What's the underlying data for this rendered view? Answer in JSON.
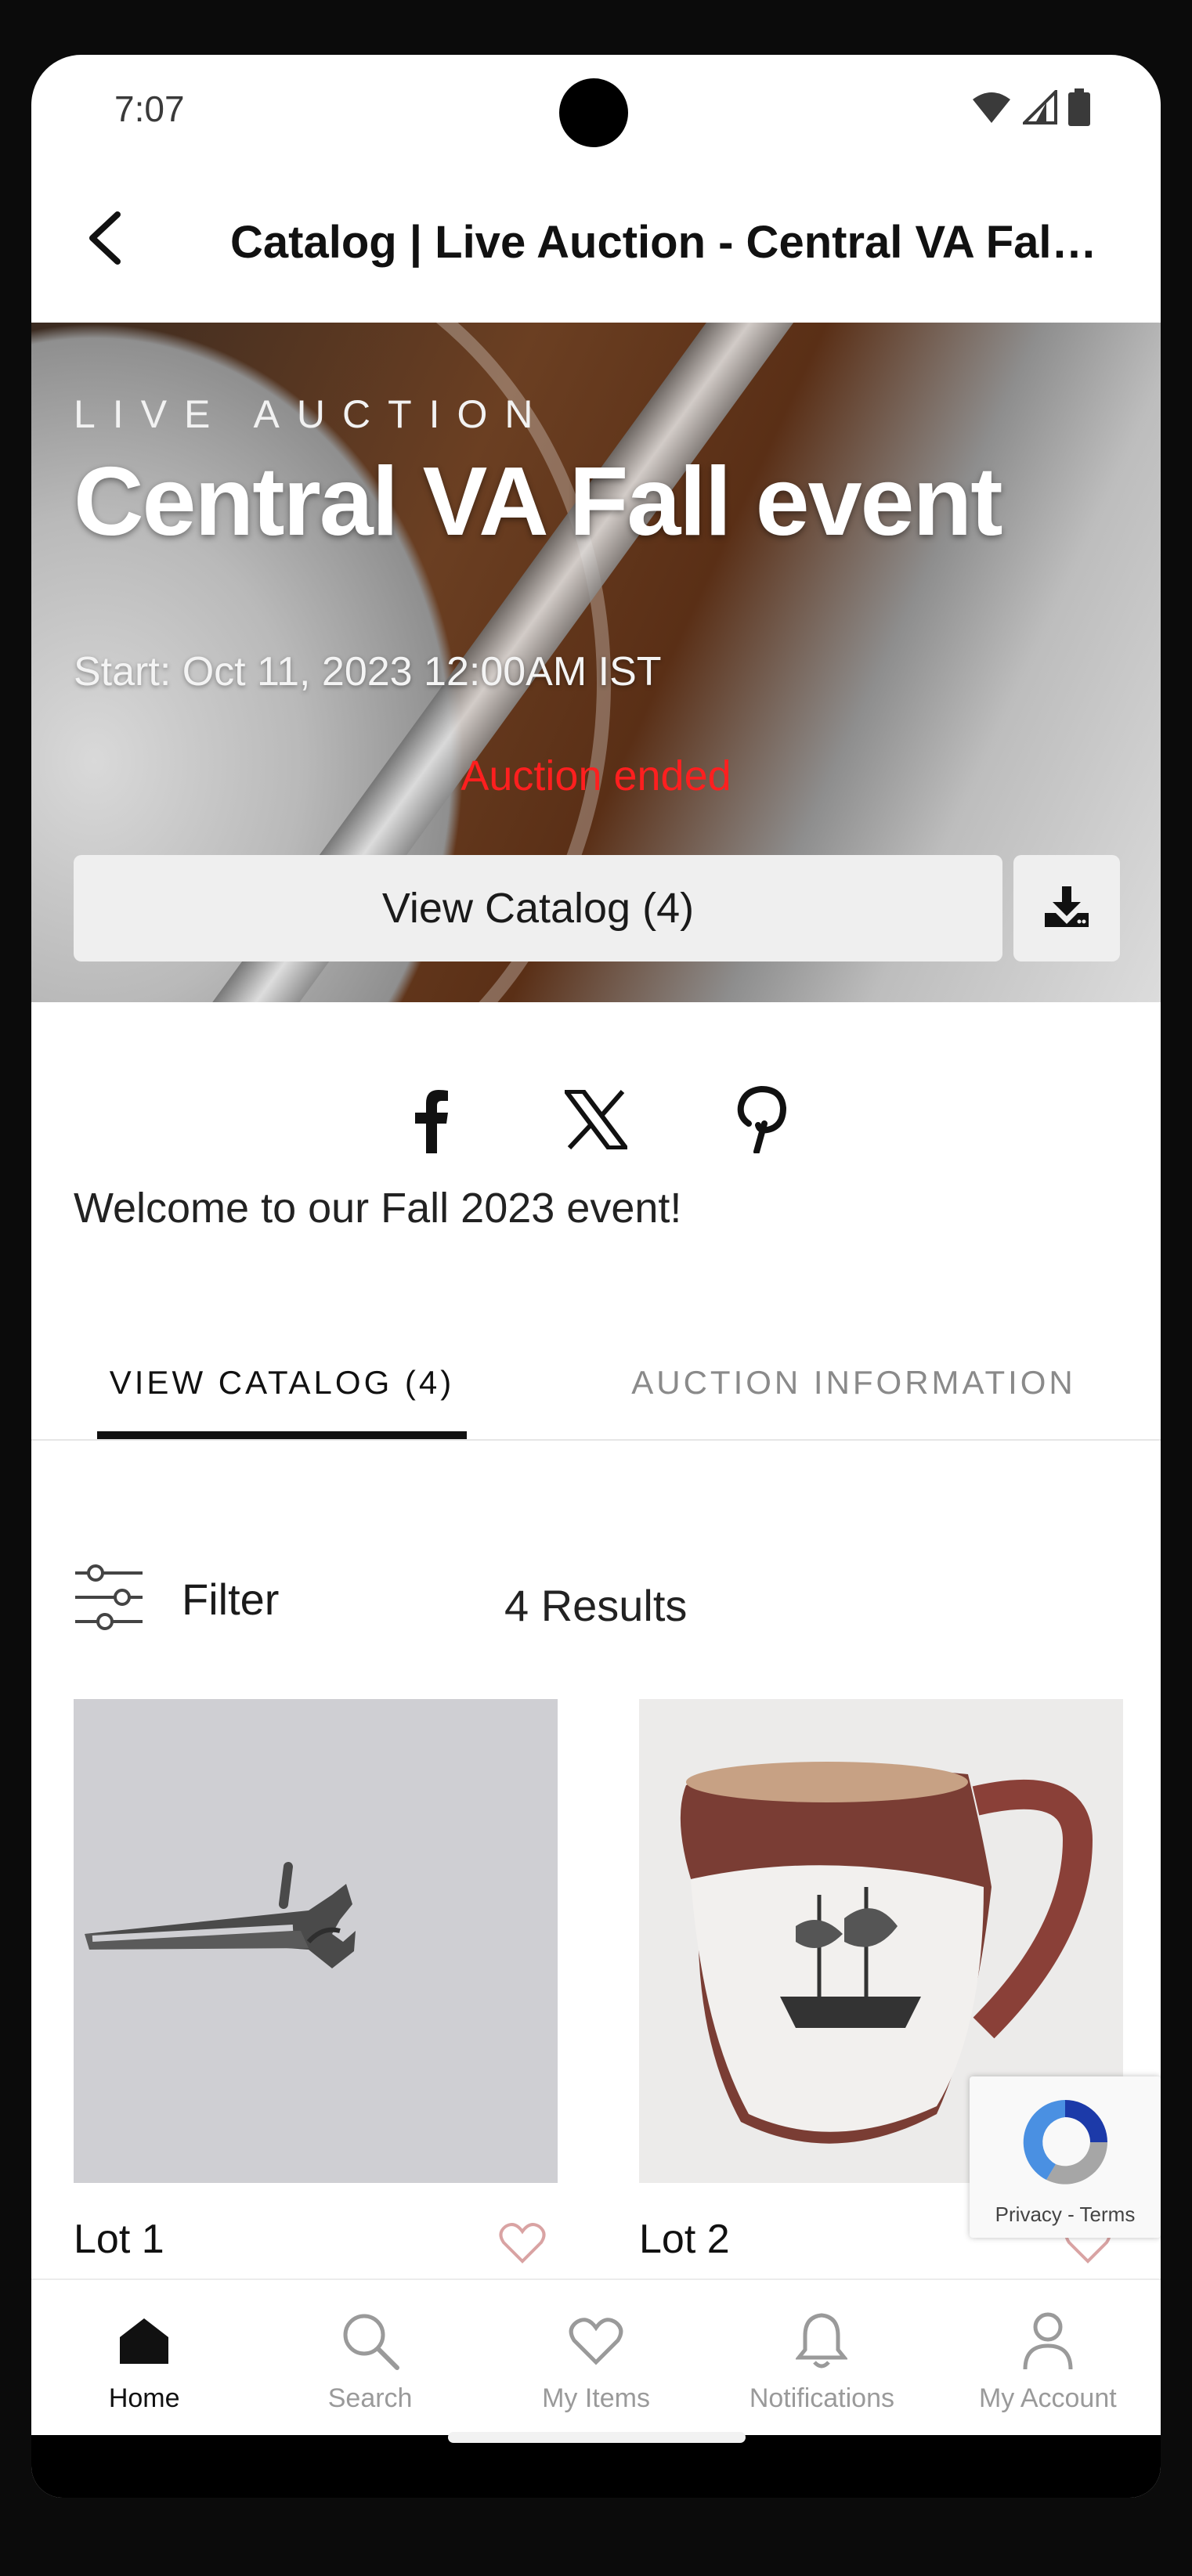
{
  "status_bar": {
    "time": "7:07"
  },
  "app_bar": {
    "title": "Catalog | Live Auction - Central VA Fall event"
  },
  "hero": {
    "eyebrow": "LIVE AUCTION",
    "title": "Central VA Fall event",
    "start": "Start: Oct 11, 2023 12:00AM IST",
    "status": "Auction ended",
    "view_catalog_label": "View Catalog (4)"
  },
  "social": [
    "facebook-icon",
    "x-icon",
    "pinterest-icon"
  ],
  "welcome": "Welcome to our Fall 2023 event!",
  "tabs": [
    {
      "label": "VIEW CATALOG (4)",
      "active": true
    },
    {
      "label": "AUCTION INFORMATION",
      "active": false
    }
  ],
  "filter": {
    "label": "Filter",
    "results": "4 Results"
  },
  "lots": [
    {
      "label": "Lot 1",
      "image": "candle-snuffer-scissors"
    },
    {
      "label": "Lot 2",
      "image": "lustreware-ship-pitcher"
    }
  ],
  "recaptcha": {
    "text": "Privacy - Terms"
  },
  "bottom_nav": [
    {
      "label": "Home",
      "icon": "home-icon",
      "active": true
    },
    {
      "label": "Search",
      "icon": "search-icon",
      "active": false
    },
    {
      "label": "My Items",
      "icon": "heart-icon",
      "active": false
    },
    {
      "label": "Notifications",
      "icon": "bell-icon",
      "active": false
    },
    {
      "label": "My Account",
      "icon": "person-icon",
      "active": false
    }
  ],
  "colors": {
    "accent": "#111111",
    "status_ended": "#ff1f1f",
    "favorite": "#d9a3a3"
  }
}
